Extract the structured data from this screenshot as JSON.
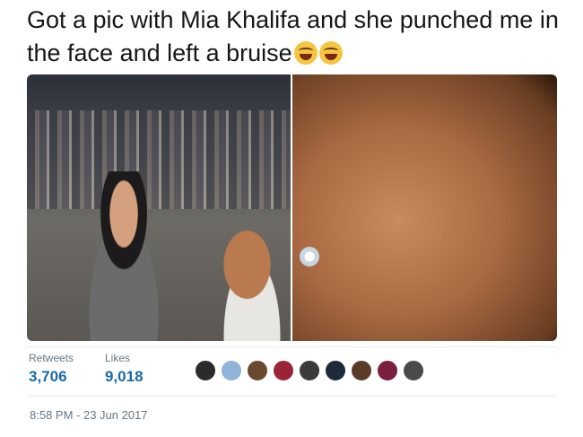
{
  "tweet": {
    "text": "Got a pic with Mia Khalifa and she punched me in the face and left a bruise",
    "emojis": [
      "face-with-tears-of-joy",
      "face-with-tears-of-joy"
    ]
  },
  "stats": {
    "retweets_label": "Retweets",
    "retweets_value": "3,706",
    "likes_label": "Likes",
    "likes_value": "9,018"
  },
  "avatars": [
    {
      "color": "#2b2b2b"
    },
    {
      "color": "#8fb3d9"
    },
    {
      "color": "#6a4a2e"
    },
    {
      "color": "#9b2335"
    },
    {
      "color": "#3a3a3a"
    },
    {
      "color": "#1d2a3a"
    },
    {
      "color": "#5a3b2a"
    },
    {
      "color": "#7a1f3d"
    },
    {
      "color": "#4a4a4a"
    }
  ],
  "timestamp": "8:58 PM - 23 Jun 2017"
}
